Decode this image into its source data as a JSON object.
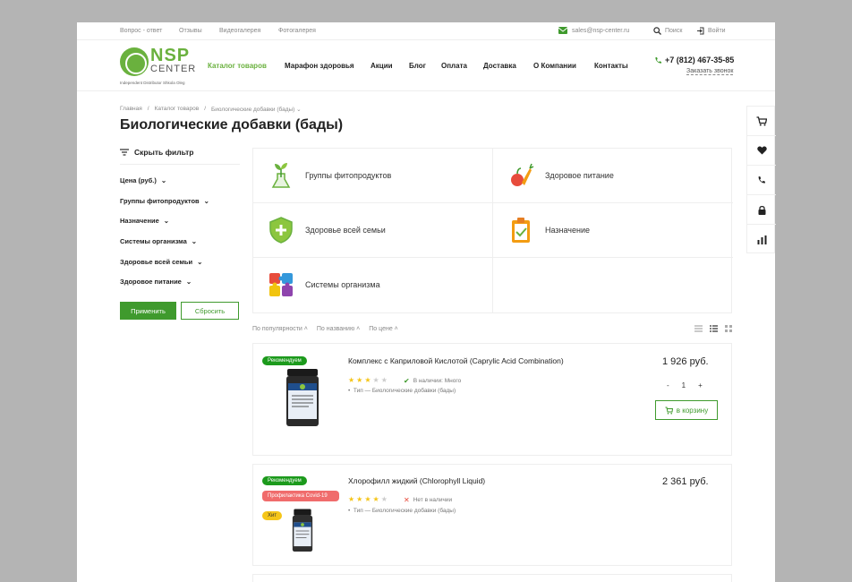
{
  "topbar": {
    "links": [
      "Вопрос - ответ",
      "Отзывы",
      "Видеогалерея",
      "Фотогалерея"
    ],
    "email": "sales@nsp-center.ru",
    "search": "Поиск",
    "login": "Войти"
  },
  "logo": {
    "nsp": "NSP",
    "center": "CENTER",
    "sub": "Independent Distributor Shkola Oleg"
  },
  "nav": [
    "Каталог товаров",
    "Марафон здоровья",
    "Акции",
    "Блог",
    "Оплата",
    "Доставка",
    "О Компании",
    "Контакты"
  ],
  "header": {
    "phone": "+7 (812) 467-35-85",
    "callback": "Заказать звонок"
  },
  "breadcrumb": [
    "Главная",
    "Каталог товаров",
    "Биологические добавки (бады)"
  ],
  "page_title": "Биологические добавки (бады)",
  "filter": {
    "hide_label": "Скрыть фильтр",
    "items": [
      "Цена (руб.)",
      "Группы фитопродуктов",
      "Назначение",
      "Системы организма",
      "Здоровье всей семьи",
      "Здоровое питание"
    ],
    "apply": "Применить",
    "reset": "Сбросить"
  },
  "categories": [
    "Группы фитопродуктов",
    "Здоровое питание",
    "Здоровье всей семьи",
    "Назначение",
    "Системы организма"
  ],
  "sort": [
    "По популярности",
    "По названию",
    "По цене"
  ],
  "products": [
    {
      "badges": [
        "Рекомендуем"
      ],
      "name": "Комплекс с Каприловой Кислотой (Caprylic Acid Combination)",
      "rating": 3,
      "availability": "В наличии: Много",
      "type": "Тип — Биологические добавки (бады)",
      "price": "1 926 руб.",
      "qty_minus": "-",
      "qty": "1",
      "qty_plus": "+",
      "cart": "в корзину"
    },
    {
      "badges": [
        "Рекомендуем",
        "Профилактика Covid-19",
        "Хит"
      ],
      "name": "Хлорофилл жидкий (Chlorophyll Liquid)",
      "rating": 4,
      "availability": "Нет в наличии",
      "type": "Тип — Биологические добавки (бады)",
      "price": "2 361 руб."
    }
  ],
  "colors": {
    "brand_green": "#6ab13e",
    "button_green": "#3f9a2d",
    "badge_red": "#f06c6c",
    "badge_yellow": "#f5c518"
  }
}
